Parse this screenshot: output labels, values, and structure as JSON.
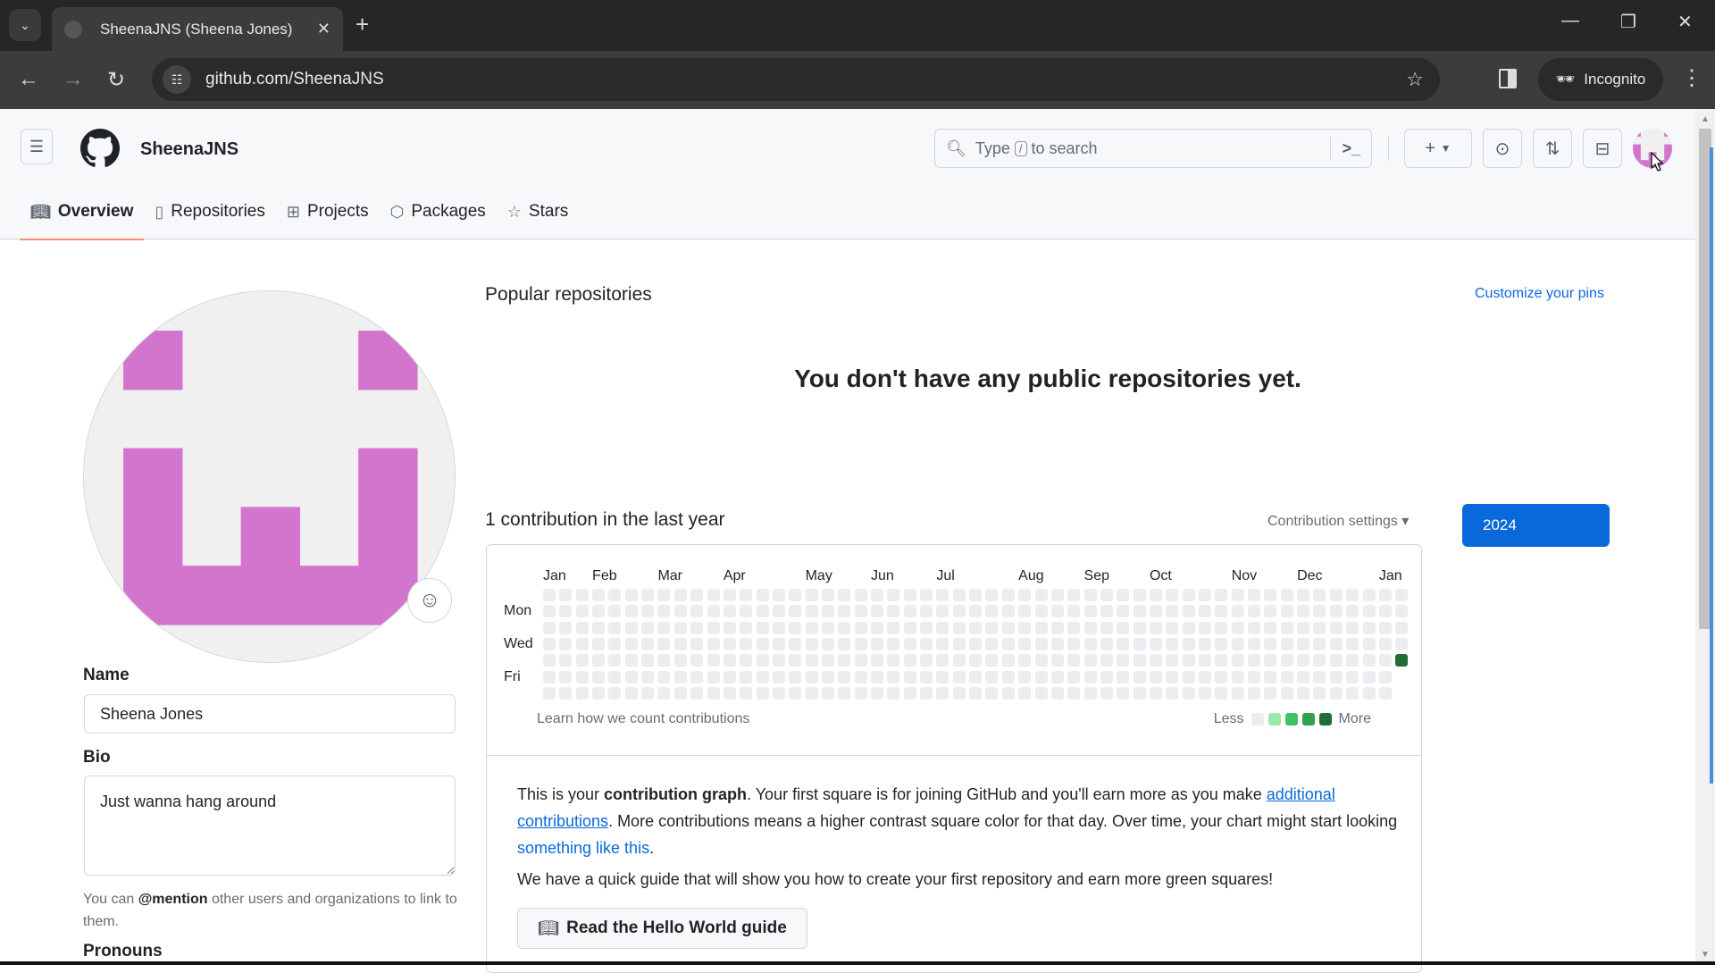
{
  "browser": {
    "tab_title": "SheenaJNS (Sheena Jones)",
    "url": "github.com/SheenaJNS",
    "incognito_label": "Incognito"
  },
  "header": {
    "username": "SheenaJNS",
    "search_prefix": "Type",
    "search_key": "/",
    "search_suffix": "to search"
  },
  "nav_tabs": [
    {
      "label": "Overview",
      "icon": "book-icon",
      "active": true
    },
    {
      "label": "Repositories",
      "icon": "repo-icon",
      "active": false
    },
    {
      "label": "Projects",
      "icon": "table-icon",
      "active": false
    },
    {
      "label": "Packages",
      "icon": "package-icon",
      "active": false
    },
    {
      "label": "Stars",
      "icon": "star-icon",
      "active": false
    }
  ],
  "profile": {
    "identicon_color": "#d375cc",
    "identicon_bg": "#f0f0f0",
    "name_label": "Name",
    "name_value": "Sheena Jones",
    "bio_label": "Bio",
    "bio_value": "Just wanna hang around",
    "hint_pre": "You can ",
    "hint_mention": "@mention",
    "hint_post": " other users and organizations to link to them.",
    "pronouns_label": "Pronouns"
  },
  "popular": {
    "title": "Popular repositories",
    "customize_label": "Customize your pins",
    "empty_message": "You don't have any public repositories yet."
  },
  "contributions": {
    "title": "1 contribution in the last year",
    "settings_label": "Contribution settings ▾",
    "year": "2024",
    "learn_label": "Learn how we count contributions",
    "legend_less": "Less",
    "legend_more": "More",
    "legend_colors": [
      "#ebedf0",
      "#9be9a8",
      "#40c463",
      "#30a14e",
      "#216e39"
    ],
    "info_1": "This is your ",
    "info_bold": "contribution graph",
    "info_2": ". Your first square is for joining GitHub and you'll earn more as you make ",
    "info_link1": "additional contributions",
    "info_3": ". More contributions means a higher contrast square color for that day. Over time, your chart might start looking ",
    "info_link2": "something like this",
    "info_4": ".",
    "guide_text": "We have a quick guide that will show you how to create your first repository and earn more green squares!",
    "guide_button": "Read the Hello World guide"
  },
  "chart_data": {
    "type": "heatmap",
    "title": "1 contribution in the last year",
    "months": [
      {
        "label": "Jan",
        "week": 0
      },
      {
        "label": "Feb",
        "week": 3
      },
      {
        "label": "Mar",
        "week": 7
      },
      {
        "label": "Apr",
        "week": 11
      },
      {
        "label": "May",
        "week": 16
      },
      {
        "label": "Jun",
        "week": 20
      },
      {
        "label": "Jul",
        "week": 24
      },
      {
        "label": "Aug",
        "week": 29
      },
      {
        "label": "Sep",
        "week": 33
      },
      {
        "label": "Oct",
        "week": 37
      },
      {
        "label": "Nov",
        "week": 42
      },
      {
        "label": "Dec",
        "week": 46
      },
      {
        "label": "Jan",
        "week": 51
      }
    ],
    "day_labels": [
      {
        "label": "Mon",
        "row": 1
      },
      {
        "label": "Wed",
        "row": 3
      },
      {
        "label": "Fri",
        "row": 5
      }
    ],
    "weeks": 53,
    "last_week_days": 5,
    "contributions": [
      {
        "week": 52,
        "day": 4,
        "level": 4,
        "count": 1
      }
    ],
    "total": 1
  }
}
